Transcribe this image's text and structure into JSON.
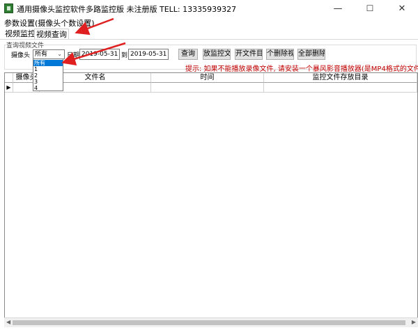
{
  "window": {
    "title": "通用摄像头监控软件多路监控版 未注册版 TELL: 13335939327",
    "controls": {
      "minimize": "—",
      "maximize": "☐",
      "close": "✕"
    }
  },
  "menu": {
    "items": [
      "参数设置(摄像头个数设置)"
    ]
  },
  "tabs": [
    {
      "label": "视频监控",
      "selected": false
    },
    {
      "label": "视频查询",
      "selected": true
    }
  ],
  "query_group": {
    "title": "查询视频文件",
    "camera_label": "摄像头",
    "camera_value": "所有",
    "camera_options": [
      "所有",
      "1",
      "2",
      "3",
      "4"
    ],
    "date_label": "日期",
    "date_from": "2019-05-31",
    "to_label": "到",
    "date_to": "2019-05-31",
    "buttons": {
      "query": "查询",
      "play": "放监控文",
      "open_folder": "开文件目",
      "delete_one": "个删除视",
      "delete_all": "全部删除"
    },
    "hint": "提示: 如果不能播放录像文件, 请安装一个暴风影音播放器(是MP4格式的文件"
  },
  "grid": {
    "columns": [
      "摄像头",
      "文件名",
      "时间",
      "监控文件存放目录"
    ],
    "row_marker": "▶"
  },
  "colors": {
    "hint_red": "#c00000",
    "selection_blue": "#0078d7",
    "arrow_red": "#e02020"
  }
}
